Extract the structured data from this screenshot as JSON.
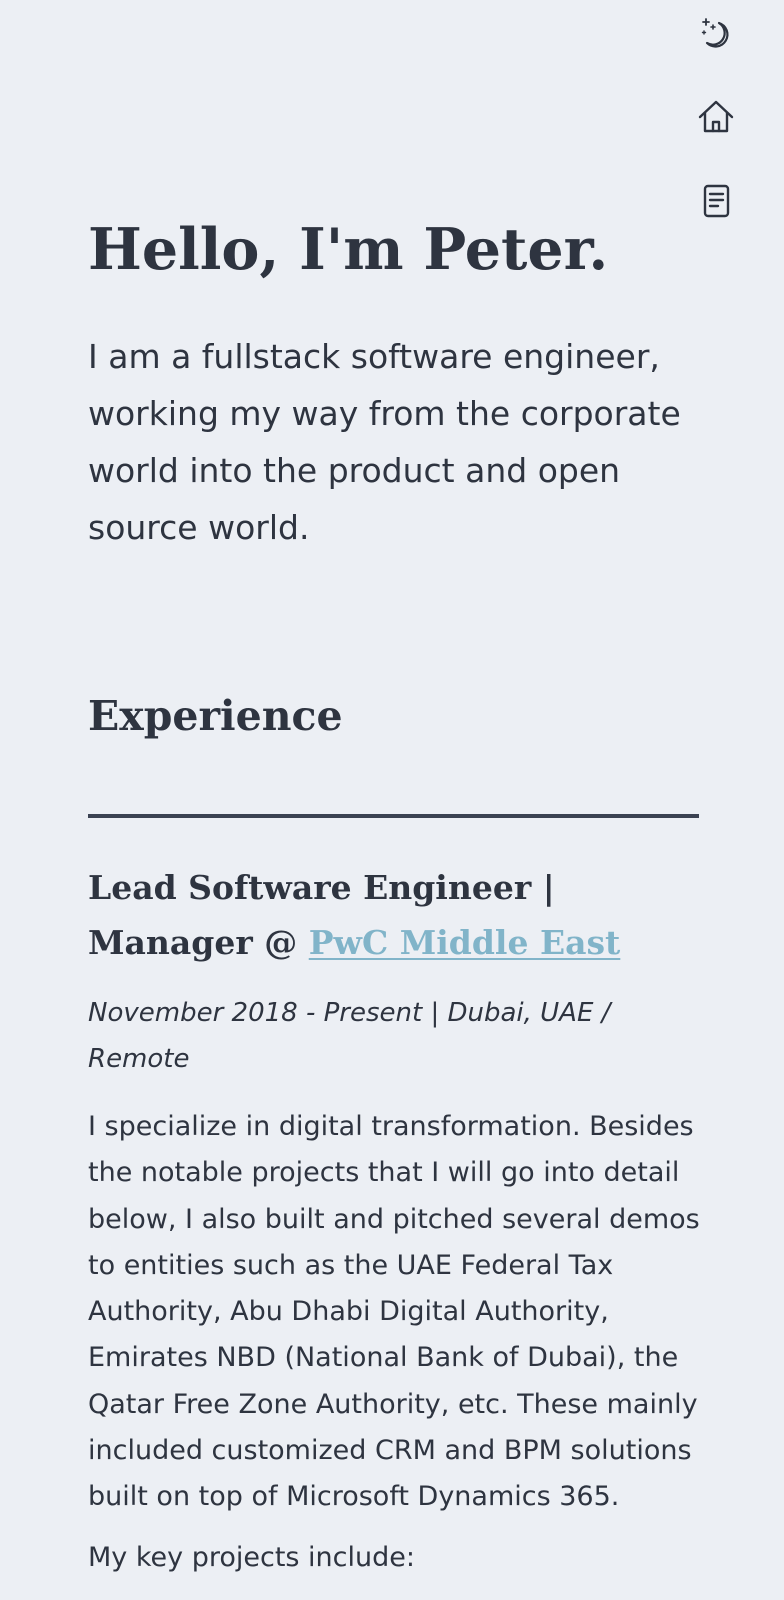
{
  "nav": {
    "icons": [
      {
        "name": "theme-toggle",
        "icon": "moon-stars-icon"
      },
      {
        "name": "home",
        "icon": "home-icon"
      },
      {
        "name": "resume",
        "icon": "document-icon"
      }
    ]
  },
  "hero": {
    "title": "Hello, I'm Peter.",
    "intro": "I am a fullstack software engineer, working my way from the corporate world into the product and open source world."
  },
  "experience": {
    "heading": "Experience",
    "jobs": [
      {
        "title": "Lead Software Engineer | Manager @ ",
        "company": "PwC Middle East",
        "meta": "November 2018 - Present | Dubai, UAE / Remote",
        "description": "I specialize in digital transformation. Besides the notable projects that I will go into detail below, I also built and pitched several demos to entities such as the UAE Federal Tax Authority, Abu Dhabi Digital Authority, Emirates NBD (National Bank of Dubai), the Qatar Free Zone Authority, etc. These mainly included customized CRM and BPM solutions built on top of Microsoft Dynamics 365.",
        "projects_intro": "My key projects include:"
      }
    ]
  },
  "colors": {
    "background": "#eceff4",
    "text": "#2e3440",
    "link": "#81b4c9"
  }
}
